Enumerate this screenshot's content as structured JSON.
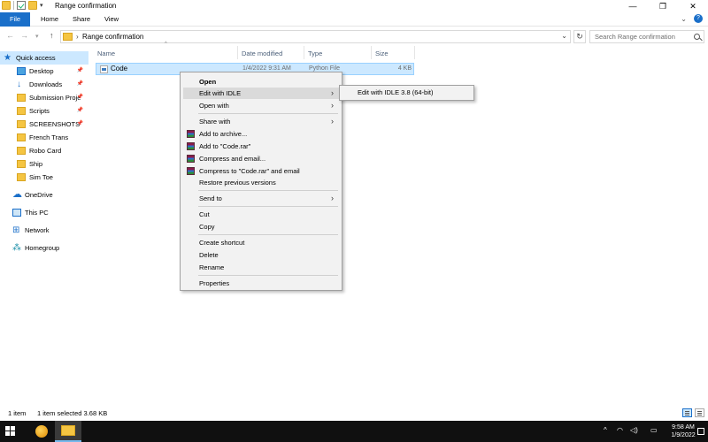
{
  "window": {
    "title": "Range confirmation",
    "controls": [
      "—",
      "❐",
      "✕"
    ]
  },
  "ribbon": {
    "tabs": [
      "File",
      "Home",
      "Share",
      "View"
    ],
    "chevron": "⌄",
    "help": "?"
  },
  "address": {
    "separator": "›",
    "path": "Range confirmation",
    "search_placeholder": "Search Range confirmation"
  },
  "nav": {
    "items": [
      {
        "label": "Quick access",
        "icon": "star-icon",
        "selected": true
      },
      {
        "label": "Desktop",
        "icon": "desktop-icon",
        "pinned": true
      },
      {
        "label": "Downloads",
        "icon": "download-icon",
        "pinned": true
      },
      {
        "label": "Submission Proje",
        "icon": "folder-icon",
        "pinned": true
      },
      {
        "label": "Scripts",
        "icon": "folder-icon",
        "pinned": true
      },
      {
        "label": "SCREENSHOTS",
        "icon": "folder-icon",
        "pinned": true
      },
      {
        "label": "French Trans",
        "icon": "folder-icon"
      },
      {
        "label": "Robo Card",
        "icon": "folder-icon"
      },
      {
        "label": "Ship",
        "icon": "folder-icon"
      },
      {
        "label": "Sim Toe",
        "icon": "folder-icon"
      },
      {
        "label": "OneDrive",
        "icon": "cloud-icon"
      },
      {
        "label": "This PC",
        "icon": "pc-icon"
      },
      {
        "label": "Network",
        "icon": "network-icon"
      },
      {
        "label": "Homegroup",
        "icon": "homegroup-icon"
      }
    ]
  },
  "columns": {
    "name": "Name",
    "date_modified": "Date modified",
    "type": "Type",
    "size": "Size"
  },
  "file": {
    "name": "Code",
    "date_modified": "1/4/2022 9:31 AM",
    "type": "Python File",
    "size": "4 KB"
  },
  "context_menu": {
    "open": "Open",
    "edit_with_idle": "Edit with IDLE",
    "open_with": "Open with",
    "share_with": "Share with",
    "add_to_archive": "Add to archive...",
    "add_to_code_rar": "Add to \"Code.rar\"",
    "compress_and_email": "Compress and email...",
    "compress_to_code_rar_email": "Compress to \"Code.rar\" and email",
    "restore_previous_versions": "Restore previous versions",
    "send_to": "Send to",
    "cut": "Cut",
    "copy": "Copy",
    "create_shortcut": "Create shortcut",
    "delete": "Delete",
    "rename": "Rename",
    "properties": "Properties",
    "submenu_arrow": "›"
  },
  "submenu": {
    "item": "Edit with IDLE 3.8 (64-bit)"
  },
  "status": {
    "item_count": "1 item",
    "selection": "1 item selected  3.68 KB"
  },
  "taskbar": {
    "time": "9:58 AM",
    "date": "1/9/2022",
    "tray_up": "^"
  },
  "colors": {
    "accent": "#1a6fc9",
    "selection": "#cce8ff",
    "taskbar": "#101010"
  }
}
